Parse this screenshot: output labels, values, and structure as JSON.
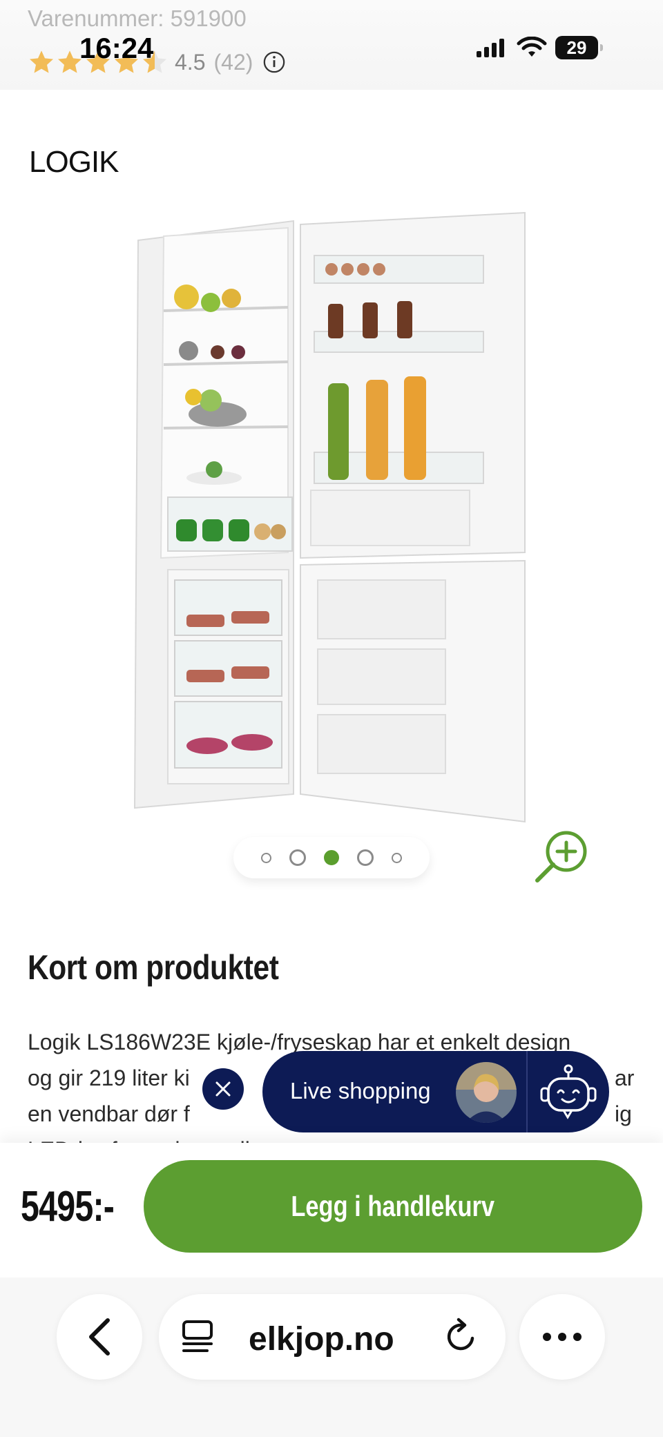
{
  "status_bar": {
    "time": "16:24",
    "battery": "29"
  },
  "product": {
    "sku_label": "Varenummer:",
    "sku_value": "591900",
    "rating": "4.5",
    "review_count": "(42)",
    "rating_stars": 4.5,
    "brand": "LOGIK"
  },
  "gallery": {
    "image_count": 5,
    "active_index": 2
  },
  "description": {
    "title": "Kort om produktet",
    "lines": [
      "Logik LS186W23E kjøle-/fryseskap har et enkelt design",
      "og gir 219 liter ki",
      "en vendbar dør f",
      "LED-lys for god oversikt"
    ],
    "line_tails": [
      "ar",
      "ig"
    ]
  },
  "live_shopping": {
    "label": "Live shopping"
  },
  "purchase": {
    "price": "5495:-",
    "add_to_cart": "Legg i handlekurv"
  },
  "browser": {
    "url": "elkjop.no"
  },
  "colors": {
    "accent_green": "#5c9e31",
    "navy": "#0d1b55",
    "star": "#f2bc57"
  }
}
